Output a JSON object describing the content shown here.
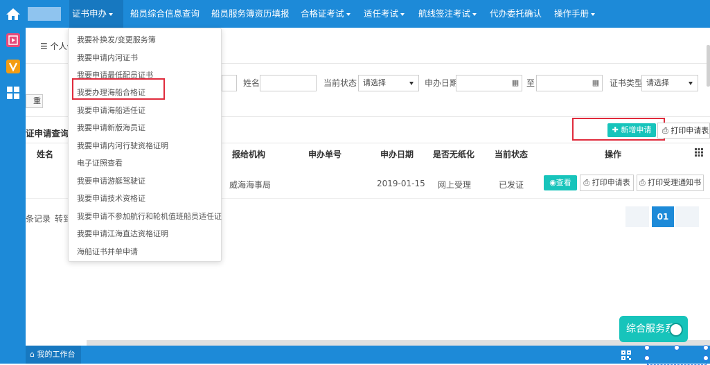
{
  "nav": {
    "items": [
      {
        "label": "证书申办",
        "dropdown": true,
        "active": true
      },
      {
        "label": "船员综合信息查询",
        "dropdown": false
      },
      {
        "label": "船员服务簿资历填报",
        "dropdown": false
      },
      {
        "label": "合格证考试",
        "dropdown": true
      },
      {
        "label": "适任考试",
        "dropdown": true
      },
      {
        "label": "航线签注考试",
        "dropdown": true
      },
      {
        "label": "代办委托确认",
        "dropdown": false
      },
      {
        "label": "操作手册",
        "dropdown": true
      }
    ]
  },
  "dropdown": {
    "items": [
      "我要补换发/变更服务簿",
      "我要申请内河证书",
      "我要申请最低配员证书",
      "我要办理海船合格证",
      "我要申请海船适任证",
      "我要申请新版海员证",
      "我要申请内河行驶资格证明",
      "电子证照查看",
      "我要申请游艇驾驶证",
      "我要申请技术资格证",
      "我要申请不参加航行和轮机值班船员适任证",
      "我要申请江海直达资格证明",
      "海船证书并单申请"
    ]
  },
  "tab": {
    "label": "个人信"
  },
  "filters": {
    "name_label": "姓名",
    "status_label": "当前状态",
    "status_value": "请选择",
    "date_label": "申办日期",
    "date_to": "至",
    "cert_type_label": "证书类型",
    "cert_type_value": "请选择",
    "reset_label": "重置"
  },
  "panel": {
    "title": "证申请查询",
    "add_label": "新增申请",
    "print_app_label": "打印申请表"
  },
  "table": {
    "headers": [
      "姓名",
      "报给机构",
      "申办单号",
      "申办日期",
      "是否无纸化",
      "当前状态",
      "操作"
    ],
    "rows": [
      {
        "agency": "威海海事局",
        "date": "2019-01-15",
        "paperless": "网上受理",
        "status": "已发证"
      }
    ],
    "actions": {
      "view": "查看",
      "print_app": "打印申请表",
      "print_notice": "打印受理通知书"
    }
  },
  "pager": {
    "records_text": "条记录",
    "goto_text": "转到",
    "current_page": "01"
  },
  "footer": {
    "workbench_label": "我的工作台",
    "service_label": "综合服务系"
  },
  "colors": {
    "nav_blue": "#1d8ad8",
    "teal": "#17c4bb",
    "highlight_red": "#e02b3c"
  }
}
